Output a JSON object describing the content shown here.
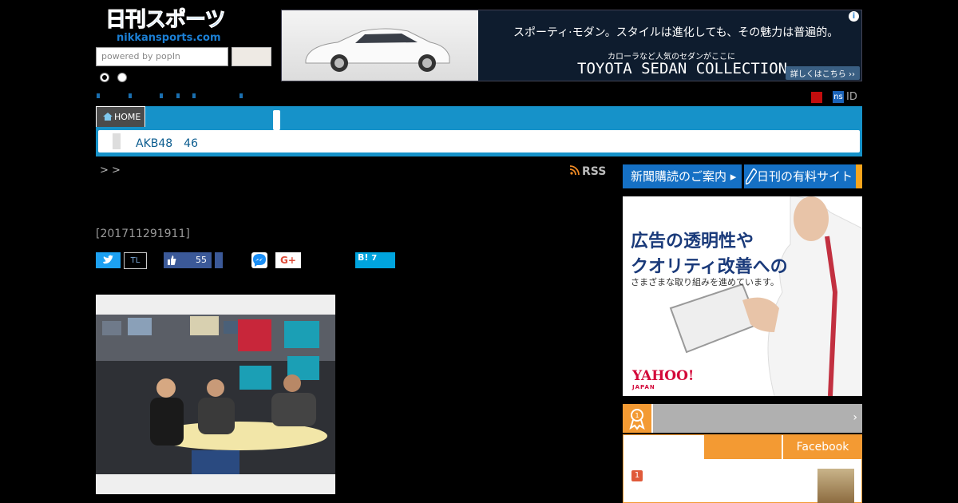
{
  "header": {
    "logo_main": "日刊スポーツ",
    "logo_sub": "nikkansports.com",
    "search_placeholder": "powered by popIn"
  },
  "ad_top": {
    "copy1": "スポーティ·モダン。スタイルは進化しても、その魅力は普遍的。",
    "copy2": "カローラなど人気のセダンがここに",
    "copy3": "TOYOTA SEDAN COLLECTION",
    "more": "詳しくはこちら ››",
    "info": "i"
  },
  "account": {
    "ns_badge": "ns",
    "id_label": "ID"
  },
  "nav": {
    "home_label": "HOME",
    "sub_link": "AKB48　46"
  },
  "article": {
    "breadcrumb": ">  >",
    "rss_label": "RSS",
    "date": "[201711291911]"
  },
  "share": {
    "twitter_icon": "twitter-bird",
    "timeline_label": "TL",
    "facebook_count": "55",
    "googleplus_label": "G+",
    "hatena_label": "B!",
    "hatena_count": "7"
  },
  "sidebar": {
    "subscribe_label": "新聞購読のご案内",
    "paid_site_label": "日刊の有料サイト",
    "ad_line1": "広告の透明性や",
    "ad_line2": "クオリティ改善への",
    "ad_sub": "さまざまな取り組みを進めています。",
    "ad_logo": "YAHOO!",
    "ad_logo_sub": "JAPAN",
    "rank_tab_facebook": "Facebook",
    "rank_first": "1"
  },
  "colors": {
    "nav_blue": "#1692c9",
    "sidebar_blue": "#1570c4",
    "orange": "#f39a33"
  }
}
